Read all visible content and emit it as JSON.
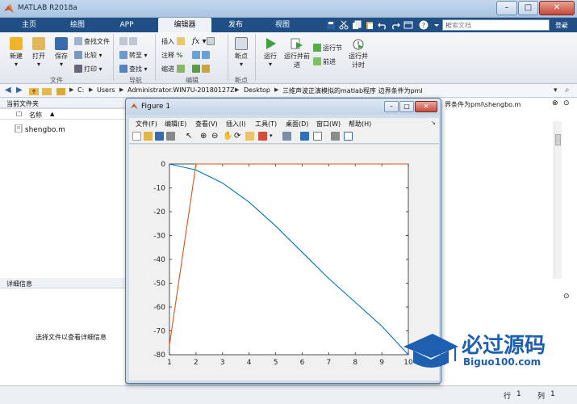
{
  "window": {
    "title": "MATLAB R2018a"
  },
  "tabs": [
    "主页",
    "绘图",
    "APP",
    "编辑器",
    "发布",
    "视图"
  ],
  "active_tab": "编辑器",
  "search": {
    "placeholder": "搜索文档"
  },
  "login_label": "登录",
  "ribbon": {
    "file_group": {
      "label": "文件",
      "new": "新建",
      "open": "打开",
      "save": "保存",
      "find_files": "查找文件",
      "compare": "比较",
      "print": "打印"
    },
    "nav_group": {
      "label": "导航",
      "goto": "转至",
      "find": "查找"
    },
    "edit_group": {
      "label": "编辑",
      "insert": "插入",
      "comment": "注释",
      "indent": "缩进",
      "fx": "fx"
    },
    "breakpoint_group": {
      "label": "断点",
      "breakpoints": "断点"
    },
    "run_group": {
      "run": "运行",
      "run_advance": "运行并前进",
      "run_section": "运行节",
      "advance": "前进",
      "run_time": "运行并计时"
    }
  },
  "address": {
    "crumbs": [
      "C:",
      "Users",
      "Administrator.WIN7U-20180127Z",
      "Desktop",
      "三维声波正演模拟的matlab程序 边界条件为pml"
    ]
  },
  "current_folder": {
    "title": "当前文件夹",
    "name_col": "名称",
    "files": [
      "shengbo.m"
    ]
  },
  "details": {
    "title": "详细信息",
    "hint": "选择文件以查看详细信息"
  },
  "editor_path": "界条件为pml\\shengbo.m",
  "statusbar": {
    "row_label": "行",
    "row": "1",
    "col_label": "列",
    "col": "1"
  },
  "figure": {
    "title": "Figure 1",
    "menu": [
      "文件(F)",
      "编辑(E)",
      "查看(V)",
      "插入(I)",
      "工具(T)",
      "桌面(D)",
      "窗口(W)",
      "帮助(H)"
    ]
  },
  "chart_data": {
    "type": "line",
    "xlim": [
      1,
      10
    ],
    "ylim": [
      -80,
      0
    ],
    "xticks": [
      1,
      2,
      3,
      4,
      5,
      6,
      7,
      8,
      9,
      10
    ],
    "yticks": [
      0,
      -10,
      -20,
      -30,
      -40,
      -50,
      -60,
      -70,
      -80
    ],
    "series": [
      {
        "color": "#0072bd",
        "x": [
          1,
          2,
          3,
          4,
          5,
          6,
          7,
          8,
          9,
          10
        ],
        "y": [
          0,
          -2.5,
          -8,
          -16,
          -26,
          -37,
          -48,
          -58,
          -68,
          -80
        ]
      },
      {
        "color": "#d95319",
        "x": [
          1,
          2,
          3,
          4,
          5,
          6,
          7,
          8,
          9,
          10
        ],
        "y": [
          -76,
          0,
          0,
          0,
          0,
          0,
          0,
          0,
          0,
          0
        ]
      }
    ],
    "grid": false
  },
  "watermark": {
    "main": "必过源码",
    "sub": "Biguo100.com"
  },
  "colors": {
    "tab_bar": "#1f4f85",
    "series1": "#0072bd",
    "series2": "#d95319"
  }
}
